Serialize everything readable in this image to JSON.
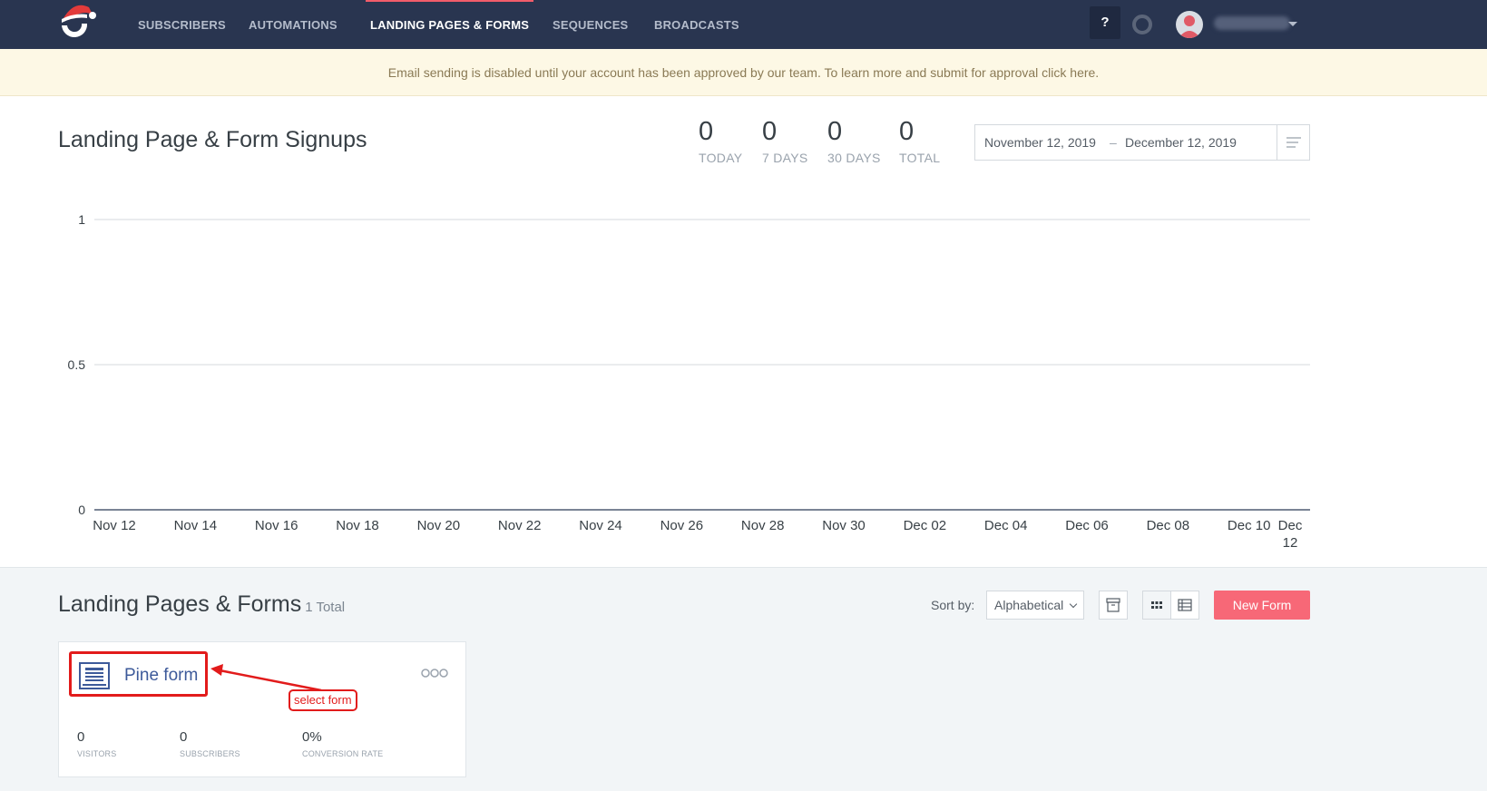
{
  "nav": {
    "items": [
      {
        "label": "SUBSCRIBERS",
        "active": false
      },
      {
        "label": "AUTOMATIONS",
        "active": false
      },
      {
        "label": "LANDING PAGES & FORMS",
        "active": true
      },
      {
        "label": "SEQUENCES",
        "active": false
      },
      {
        "label": "BROADCASTS",
        "active": false
      }
    ],
    "help_label": "?",
    "logo_icon": "santa-hat-logo-icon",
    "accent_color": "#f25c6a",
    "background_color": "#293550"
  },
  "banner": {
    "text": "Email sending is disabled until your account has been approved by our team. To learn more and submit for approval click here."
  },
  "signups": {
    "title": "Landing Page & Form Signups",
    "stats": [
      {
        "value": "0",
        "label": "TODAY"
      },
      {
        "value": "0",
        "label": "7 DAYS"
      },
      {
        "value": "0",
        "label": "30 DAYS"
      },
      {
        "value": "0",
        "label": "TOTAL"
      }
    ],
    "date_start": "November 12, 2019",
    "date_separator": "–",
    "date_end": "December 12, 2019"
  },
  "chart_data": {
    "type": "line",
    "title": "",
    "xlabel": "",
    "ylabel": "",
    "x_tick_labels": [
      "Nov 12",
      "Nov 14",
      "Nov 16",
      "Nov 18",
      "Nov 20",
      "Nov 22",
      "Nov 24",
      "Nov 26",
      "Nov 28",
      "Nov 30",
      "Dec 02",
      "Dec 04",
      "Dec 06",
      "Dec 08",
      "Dec 10",
      "Dec 12"
    ],
    "y_tick_labels": [
      "0",
      "0.5",
      "1"
    ],
    "ylim": [
      0,
      1
    ],
    "grid": true,
    "series": [
      {
        "values": [
          0,
          0,
          0,
          0,
          0,
          0,
          0,
          0,
          0,
          0,
          0,
          0,
          0,
          0,
          0,
          0
        ]
      }
    ]
  },
  "forms_section": {
    "title": "Landing Pages & Forms",
    "count": "1 Total",
    "sort_label": "Sort by:",
    "sort_value": "Alphabetical",
    "new_button": "New Form",
    "new_button_color": "#f76877"
  },
  "form_card": {
    "name": "Pine form",
    "stats": [
      {
        "value": "0",
        "label": "VISITORS"
      },
      {
        "value": "0",
        "label": "SUBSCRIBERS"
      },
      {
        "value": "0%",
        "label": "CONVERSION RATE"
      }
    ]
  },
  "annotation": {
    "label": "select form",
    "color": "#e21b1b"
  }
}
